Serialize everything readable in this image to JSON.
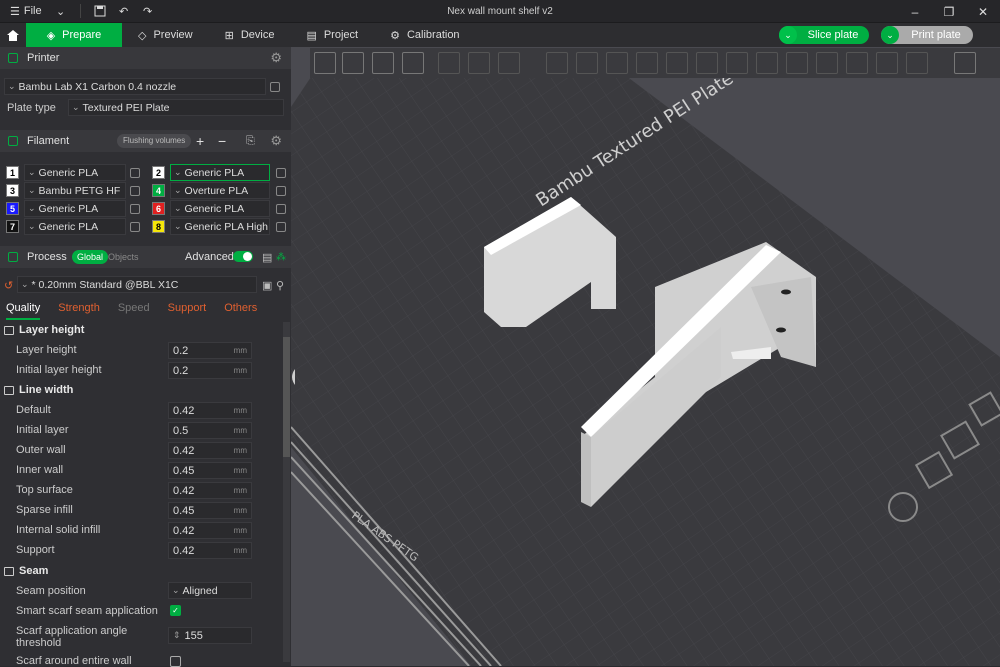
{
  "titlebar": {
    "file_label": "File",
    "title": "Nex wall mount shelf v2"
  },
  "tabs": [
    {
      "label": "Prepare"
    },
    {
      "label": "Preview"
    },
    {
      "label": "Device"
    },
    {
      "label": "Project"
    },
    {
      "label": "Calibration"
    }
  ],
  "actions": {
    "slice": "Slice plate",
    "print": "Print plate"
  },
  "printer": {
    "header": "Printer",
    "model": "Bambu Lab X1 Carbon 0.4 nozzle",
    "plate_type_label": "Plate type",
    "plate_type": "Textured PEI Plate"
  },
  "filament": {
    "header": "Filament",
    "flushing": "Flushing volumes",
    "slots": [
      {
        "num": "1",
        "name": "Generic PLA",
        "color": "#ffffff",
        "text": "#000000"
      },
      {
        "num": "2",
        "name": "Generic PLA",
        "color": "#ffffff",
        "text": "#000000"
      },
      {
        "num": "3",
        "name": "Bambu PETG HF",
        "color": "#ffffff",
        "text": "#000000"
      },
      {
        "num": "4",
        "name": "Overture PLA",
        "color": "#00ae42",
        "text": "#ffffff"
      },
      {
        "num": "5",
        "name": "Generic PLA",
        "color": "#1a1aff",
        "text": "#ffffff"
      },
      {
        "num": "6",
        "name": "Generic PLA",
        "color": "#e02020",
        "text": "#ffffff"
      },
      {
        "num": "7",
        "name": "Generic PLA",
        "color": "#111111",
        "text": "#ffffff"
      },
      {
        "num": "8",
        "name": "Generic PLA High S...",
        "color": "#f5e60a",
        "text": "#000000"
      }
    ]
  },
  "process": {
    "header": "Process",
    "global": "Global",
    "objects": "Objects",
    "advanced": "Advanced",
    "profile": "* 0.20mm Standard @BBL X1C",
    "subtabs": [
      "Quality",
      "Strength",
      "Speed",
      "Support",
      "Others"
    ]
  },
  "settings": {
    "layer_height_group": "Layer height",
    "layer_height": {
      "label": "Layer height",
      "value": "0.2"
    },
    "initial_layer_height": {
      "label": "Initial layer height",
      "value": "0.2"
    },
    "line_width_group": "Line width",
    "default": {
      "label": "Default",
      "value": "0.42"
    },
    "initial_layer": {
      "label": "Initial layer",
      "value": "0.5"
    },
    "outer_wall": {
      "label": "Outer wall",
      "value": "0.42"
    },
    "inner_wall": {
      "label": "Inner wall",
      "value": "0.45"
    },
    "top_surface": {
      "label": "Top surface",
      "value": "0.42"
    },
    "sparse_infill": {
      "label": "Sparse infill",
      "value": "0.45"
    },
    "internal_solid_infill": {
      "label": "Internal solid infill",
      "value": "0.42"
    },
    "support": {
      "label": "Support",
      "value": "0.42"
    },
    "unit": "mm",
    "seam_group": "Seam",
    "seam_position": {
      "label": "Seam position",
      "value": "Aligned"
    },
    "smart_scarf": {
      "label": "Smart scarf seam application"
    },
    "scarf_angle": {
      "label1": "Scarf application angle",
      "label2": "threshold",
      "value": "155"
    },
    "scarf_entire": {
      "label": "Scarf around entire wall"
    }
  },
  "plate": {
    "name": "Bambu Textured PEI Plate",
    "badge": "PLA ABS PETG"
  },
  "colors": {
    "accent": "#00ae42",
    "panel": "#2f2f33",
    "bed": "#3a3a3e"
  }
}
